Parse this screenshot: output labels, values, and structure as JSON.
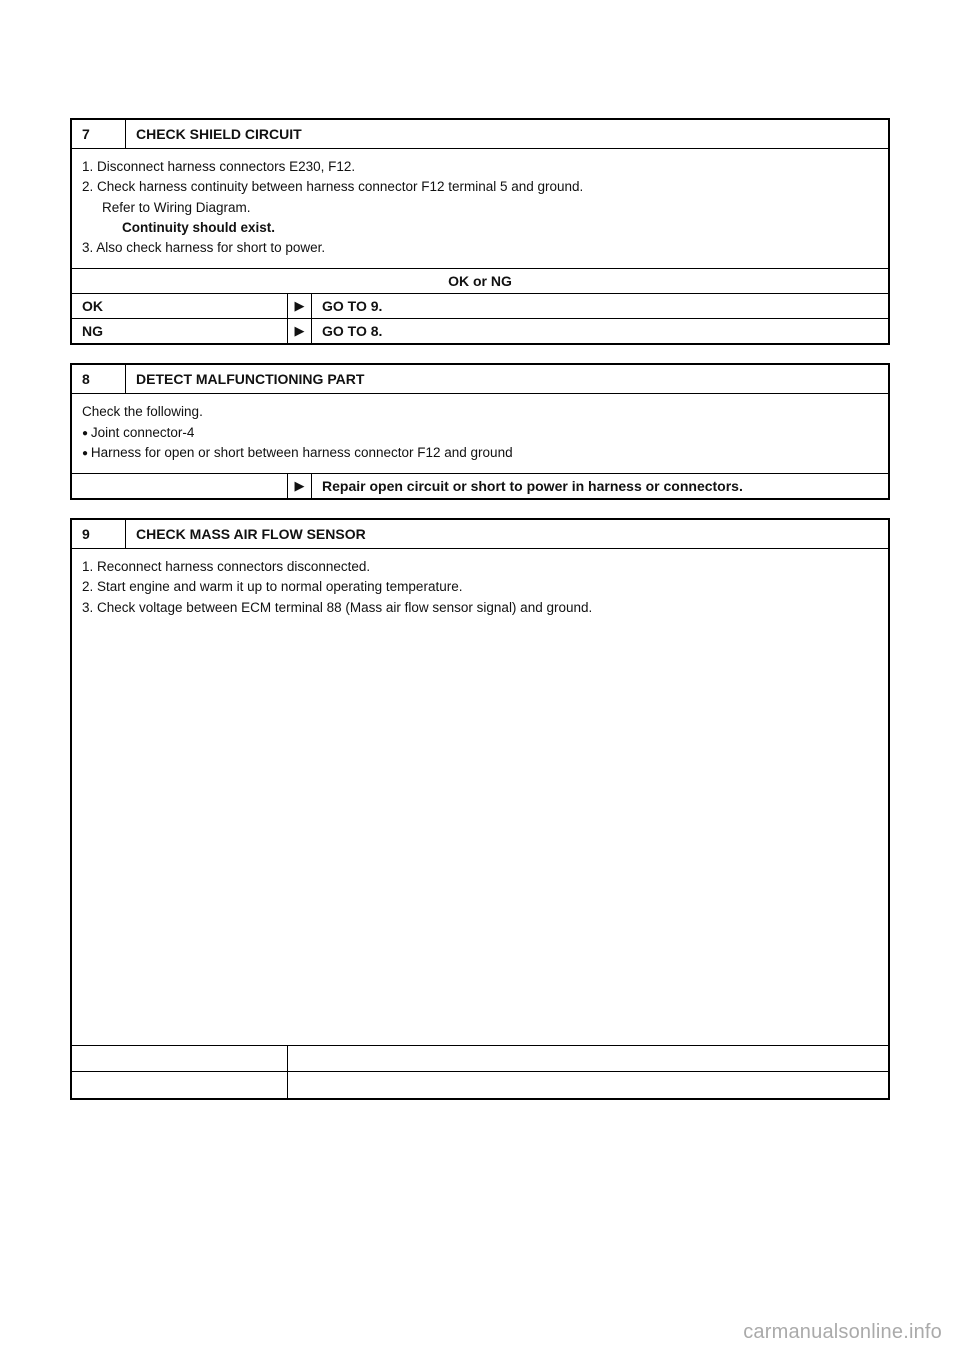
{
  "step7": {
    "num": "7",
    "title": "CHECK SHIELD CIRCUIT",
    "line1": "1. Disconnect harness connectors E230, F12.",
    "line2": "2. Check harness continuity between harness connector F12 terminal 5 and ground.",
    "line2a": "Refer to Wiring Diagram.",
    "line2b": "Continuity should exist.",
    "line3": "3. Also check harness for short to power.",
    "okng": "OK or NG",
    "ok_label": "OK",
    "ok_action": "GO TO 9.",
    "ng_label": "NG",
    "ng_action": "GO TO 8."
  },
  "step8": {
    "num": "8",
    "title": "DETECT MALFUNCTIONING PART",
    "intro": "Check the following.",
    "bullet1": "Joint connector-4",
    "bullet2": "Harness for open or short between harness connector F12 and ground",
    "action": "Repair open circuit or short to power in harness or connectors."
  },
  "step9": {
    "num": "9",
    "title": "CHECK MASS AIR FLOW SENSOR",
    "line1": "1. Reconnect harness connectors disconnected.",
    "line2": "2. Start engine and warm it up to normal operating temperature.",
    "line3": "3. Check voltage between ECM terminal 88 (Mass air flow sensor signal) and ground."
  },
  "glyphs": {
    "arrow": "▶"
  },
  "watermark": "carmanualsonline.info"
}
